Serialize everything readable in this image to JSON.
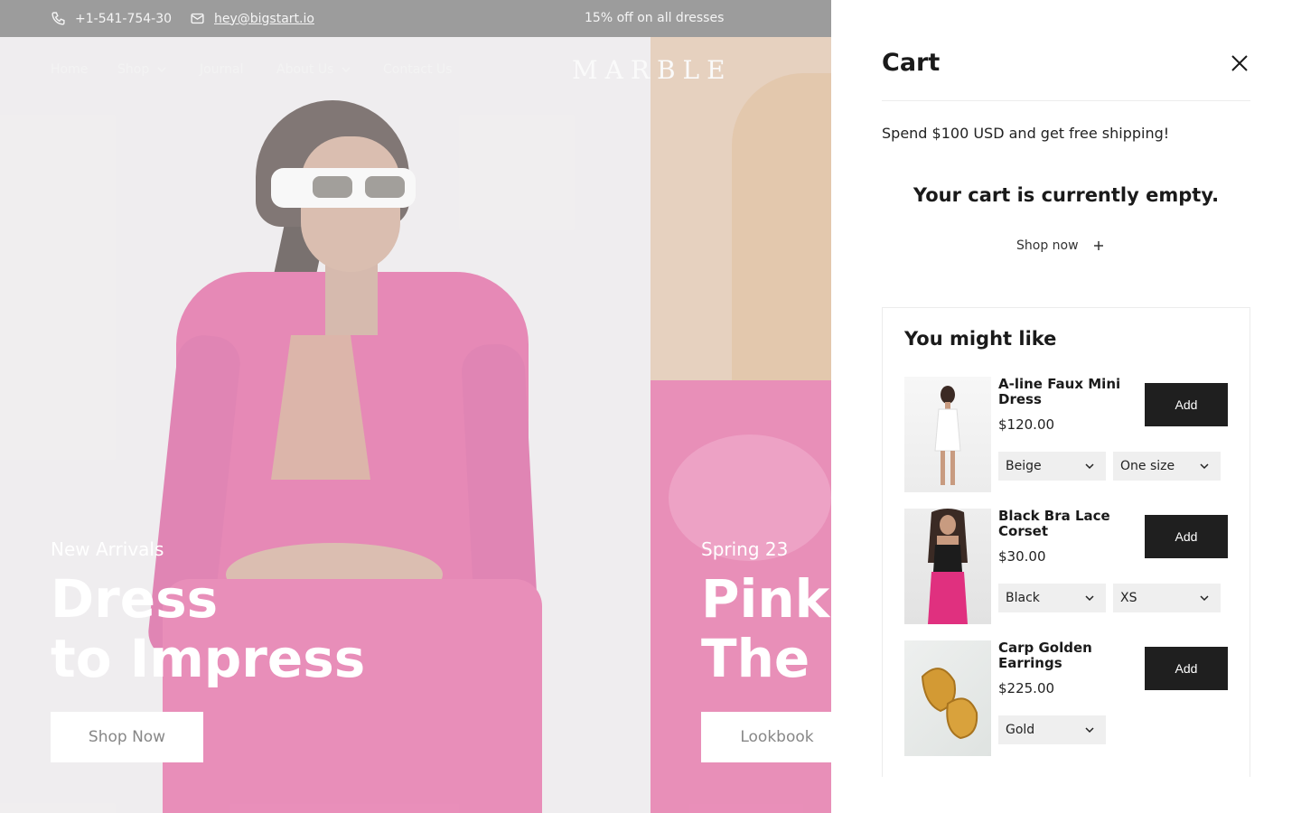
{
  "announcement": {
    "phone": "+1-541-754-30",
    "email": "hey@bigstart.io",
    "promo": "15% off on all dresses"
  },
  "nav": {
    "items": [
      "Home",
      "Shop",
      "Journal",
      "About Us",
      "Contact Us"
    ],
    "logo": "MARBLE"
  },
  "hero": [
    {
      "subtitle": "New Arrivals",
      "title_line1": "Dress",
      "title_line2": "to Impress",
      "button": "Shop Now"
    },
    {
      "subtitle": "Spring 23",
      "title_line1": "Pink",
      "title_line2": "The M",
      "button": "Lookbook"
    }
  ],
  "cart": {
    "title": "Cart",
    "shipping_message": "Spend $100 USD and get free shipping!",
    "empty_message": "Your cart is currently empty.",
    "shop_now": "Shop now",
    "upsell_title": "You might like",
    "products": [
      {
        "name": "A-line Faux Mini Dress",
        "price": "$120.00",
        "add": "Add",
        "options": [
          "Beige",
          "One size"
        ]
      },
      {
        "name": "Black Bra Lace Corset",
        "price": "$30.00",
        "add": "Add",
        "options": [
          "Black",
          "XS"
        ]
      },
      {
        "name": "Carp Golden Earrings",
        "price": "$225.00",
        "add": "Add",
        "options": [
          "Gold"
        ]
      }
    ]
  },
  "colors": {
    "brand_pink": "#d8468c",
    "button_dark": "#1f1f1f",
    "announce_bar": "#8f8f8f"
  }
}
